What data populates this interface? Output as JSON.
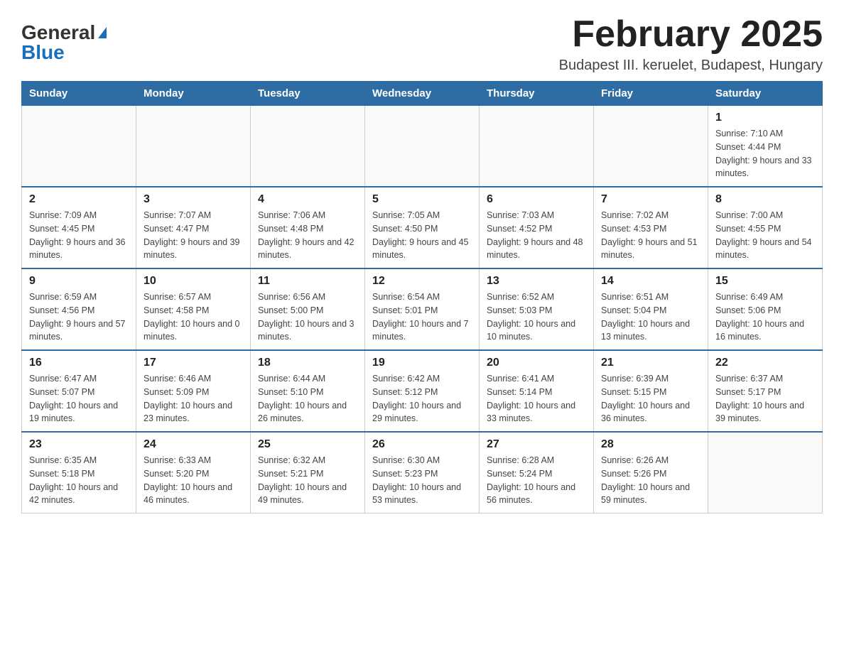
{
  "header": {
    "logo_general": "General",
    "logo_blue": "Blue",
    "title": "February 2025",
    "subtitle": "Budapest III. keruelet, Budapest, Hungary"
  },
  "weekdays": [
    "Sunday",
    "Monday",
    "Tuesday",
    "Wednesday",
    "Thursday",
    "Friday",
    "Saturday"
  ],
  "weeks": [
    [
      {
        "day": "",
        "info": ""
      },
      {
        "day": "",
        "info": ""
      },
      {
        "day": "",
        "info": ""
      },
      {
        "day": "",
        "info": ""
      },
      {
        "day": "",
        "info": ""
      },
      {
        "day": "",
        "info": ""
      },
      {
        "day": "1",
        "info": "Sunrise: 7:10 AM\nSunset: 4:44 PM\nDaylight: 9 hours and 33 minutes."
      }
    ],
    [
      {
        "day": "2",
        "info": "Sunrise: 7:09 AM\nSunset: 4:45 PM\nDaylight: 9 hours and 36 minutes."
      },
      {
        "day": "3",
        "info": "Sunrise: 7:07 AM\nSunset: 4:47 PM\nDaylight: 9 hours and 39 minutes."
      },
      {
        "day": "4",
        "info": "Sunrise: 7:06 AM\nSunset: 4:48 PM\nDaylight: 9 hours and 42 minutes."
      },
      {
        "day": "5",
        "info": "Sunrise: 7:05 AM\nSunset: 4:50 PM\nDaylight: 9 hours and 45 minutes."
      },
      {
        "day": "6",
        "info": "Sunrise: 7:03 AM\nSunset: 4:52 PM\nDaylight: 9 hours and 48 minutes."
      },
      {
        "day": "7",
        "info": "Sunrise: 7:02 AM\nSunset: 4:53 PM\nDaylight: 9 hours and 51 minutes."
      },
      {
        "day": "8",
        "info": "Sunrise: 7:00 AM\nSunset: 4:55 PM\nDaylight: 9 hours and 54 minutes."
      }
    ],
    [
      {
        "day": "9",
        "info": "Sunrise: 6:59 AM\nSunset: 4:56 PM\nDaylight: 9 hours and 57 minutes."
      },
      {
        "day": "10",
        "info": "Sunrise: 6:57 AM\nSunset: 4:58 PM\nDaylight: 10 hours and 0 minutes."
      },
      {
        "day": "11",
        "info": "Sunrise: 6:56 AM\nSunset: 5:00 PM\nDaylight: 10 hours and 3 minutes."
      },
      {
        "day": "12",
        "info": "Sunrise: 6:54 AM\nSunset: 5:01 PM\nDaylight: 10 hours and 7 minutes."
      },
      {
        "day": "13",
        "info": "Sunrise: 6:52 AM\nSunset: 5:03 PM\nDaylight: 10 hours and 10 minutes."
      },
      {
        "day": "14",
        "info": "Sunrise: 6:51 AM\nSunset: 5:04 PM\nDaylight: 10 hours and 13 minutes."
      },
      {
        "day": "15",
        "info": "Sunrise: 6:49 AM\nSunset: 5:06 PM\nDaylight: 10 hours and 16 minutes."
      }
    ],
    [
      {
        "day": "16",
        "info": "Sunrise: 6:47 AM\nSunset: 5:07 PM\nDaylight: 10 hours and 19 minutes."
      },
      {
        "day": "17",
        "info": "Sunrise: 6:46 AM\nSunset: 5:09 PM\nDaylight: 10 hours and 23 minutes."
      },
      {
        "day": "18",
        "info": "Sunrise: 6:44 AM\nSunset: 5:10 PM\nDaylight: 10 hours and 26 minutes."
      },
      {
        "day": "19",
        "info": "Sunrise: 6:42 AM\nSunset: 5:12 PM\nDaylight: 10 hours and 29 minutes."
      },
      {
        "day": "20",
        "info": "Sunrise: 6:41 AM\nSunset: 5:14 PM\nDaylight: 10 hours and 33 minutes."
      },
      {
        "day": "21",
        "info": "Sunrise: 6:39 AM\nSunset: 5:15 PM\nDaylight: 10 hours and 36 minutes."
      },
      {
        "day": "22",
        "info": "Sunrise: 6:37 AM\nSunset: 5:17 PM\nDaylight: 10 hours and 39 minutes."
      }
    ],
    [
      {
        "day": "23",
        "info": "Sunrise: 6:35 AM\nSunset: 5:18 PM\nDaylight: 10 hours and 42 minutes."
      },
      {
        "day": "24",
        "info": "Sunrise: 6:33 AM\nSunset: 5:20 PM\nDaylight: 10 hours and 46 minutes."
      },
      {
        "day": "25",
        "info": "Sunrise: 6:32 AM\nSunset: 5:21 PM\nDaylight: 10 hours and 49 minutes."
      },
      {
        "day": "26",
        "info": "Sunrise: 6:30 AM\nSunset: 5:23 PM\nDaylight: 10 hours and 53 minutes."
      },
      {
        "day": "27",
        "info": "Sunrise: 6:28 AM\nSunset: 5:24 PM\nDaylight: 10 hours and 56 minutes."
      },
      {
        "day": "28",
        "info": "Sunrise: 6:26 AM\nSunset: 5:26 PM\nDaylight: 10 hours and 59 minutes."
      },
      {
        "day": "",
        "info": ""
      }
    ]
  ]
}
